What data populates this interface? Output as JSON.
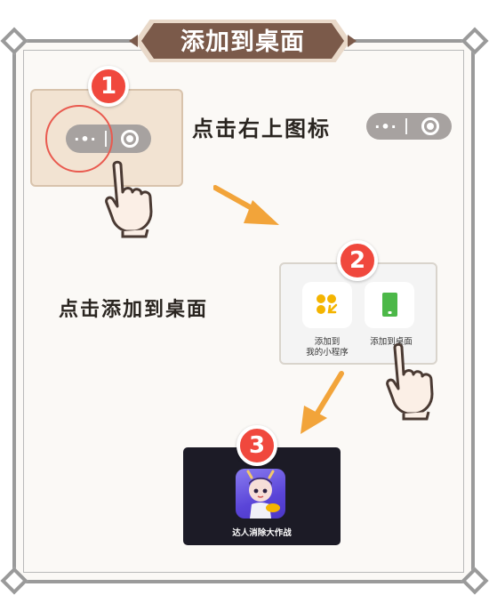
{
  "title": "添加到桌面",
  "steps": [
    {
      "number": "1",
      "instruction": "点击右上图标"
    },
    {
      "number": "2",
      "instruction": "点击添加到桌面"
    },
    {
      "number": "3",
      "instruction": ""
    }
  ],
  "capsule": {
    "dots": "·•·"
  },
  "menu": {
    "option_1": {
      "label_line1": "添加到",
      "label_line2": "我的小程序"
    },
    "option_2": {
      "label": "添加到桌面"
    }
  },
  "desktop": {
    "app_name": "达人消除大作战"
  },
  "colors": {
    "banner": "#7b5a4a",
    "badge": "#f0483d",
    "arrow": "#f2a43a",
    "accent_yellow": "#f4b400",
    "accent_green": "#4cb848",
    "dark_bg": "#1c1b26"
  }
}
